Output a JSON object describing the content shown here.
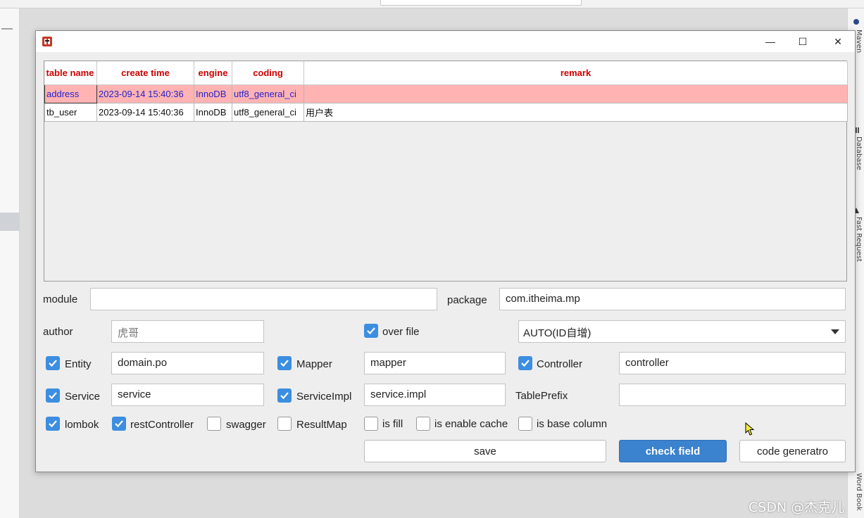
{
  "window": {
    "minimize_glyph": "—",
    "maximize_glyph": "☐",
    "close_glyph": "✕"
  },
  "table": {
    "headers": [
      "table name",
      "create time",
      "engine",
      "coding",
      "remark"
    ],
    "rows": [
      [
        "address",
        "2023-09-14 15:40:36",
        "InnoDB",
        "utf8_general_ci",
        ""
      ],
      [
        "tb_user",
        "2023-09-14 15:40:36",
        "InnoDB",
        "utf8_general_ci",
        "用户表"
      ]
    ],
    "selected_row": 0
  },
  "form": {
    "module_label": "module",
    "module_value": "",
    "package_label": "package",
    "package_value": "com.itheima.mp",
    "author_label": "author",
    "author_placeholder": "虎哥",
    "over_file_label": "over file",
    "over_file_checked": true,
    "id_type_selected": "AUTO(ID自增)",
    "entity_label": "Entity",
    "entity_checked": true,
    "entity_value": "domain.po",
    "mapper_label": "Mapper",
    "mapper_checked": true,
    "mapper_value": "mapper",
    "controller_label": "Controller",
    "controller_checked": true,
    "controller_value": "controller",
    "service_label": "Service",
    "service_checked": true,
    "service_value": "service",
    "serviceimpl_label": "ServiceImpl",
    "serviceimpl_checked": true,
    "serviceimpl_value": "service.impl",
    "tableprefix_label": "TablePrefix",
    "tableprefix_value": "",
    "lombok_label": "lombok",
    "lombok_checked": true,
    "restcontroller_label": "restController",
    "restcontroller_checked": true,
    "swagger_label": "swagger",
    "swagger_checked": false,
    "resultmap_label": "ResultMap",
    "resultmap_checked": false,
    "isfill_label": "is fill",
    "isfill_checked": false,
    "enablecache_label": "is enable cache",
    "enablecache_checked": false,
    "basecolumn_label": "is base column",
    "basecolumn_checked": false
  },
  "buttons": {
    "save": "save",
    "check_field": "check field",
    "code_generatro": "code generatro"
  },
  "ide_sidebar": {
    "tabs": [
      "Maven",
      "Database",
      "Fast Request",
      "Word Book"
    ]
  },
  "watermark": "CSDN @杰克儿",
  "colors": {
    "header_text": "#cc0000",
    "selected_row_bg": "#ffb3b3",
    "selected_row_text": "#2222cc",
    "checkbox_on": "#3c8ee0",
    "primary_button": "#3b82cf"
  }
}
